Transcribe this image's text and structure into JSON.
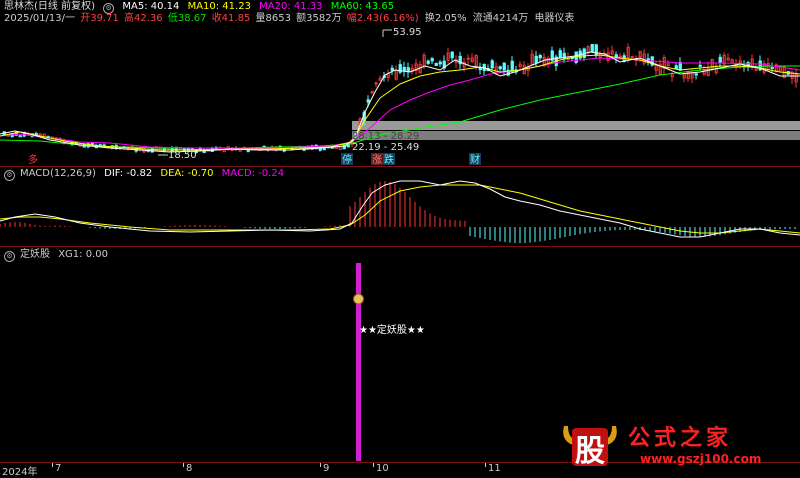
{
  "header": {
    "stock": "思林杰(日线 前复权)",
    "ma5": "MA5: 40.14",
    "ma10": "MA10: 41.23",
    "ma20": "MA20: 41.33",
    "ma60": "MA60: 43.65",
    "date": "2025/01/13/一",
    "open": "开39.71",
    "high": "高42.36",
    "low": "低38.67",
    "close": "收41.85",
    "volume": "量8653",
    "amount": "额3582万",
    "change": "幅2.43(6.16%)",
    "turnover": "换2.05%",
    "float": "流通4214万",
    "sector": "电器仪表"
  },
  "price_chart": {
    "high_label": "53.95",
    "low_label": "18.50",
    "range1": "28.13 - 28.29",
    "range2": "22.19 - 25.49",
    "marks": {
      "ting": "停",
      "zhang": "涨",
      "die": "跌",
      "cai": "财",
      "left": "多"
    }
  },
  "macd": {
    "title": "MACD(12,26,9)",
    "dif": "DIF: -0.82",
    "dea": "DEA: -0.70",
    "macd": "MACD: -0.24"
  },
  "indicator": {
    "title": "定妖股",
    "xg1": "XG1: 0.00",
    "signal": "★★定妖股★★"
  },
  "axis": {
    "labels": [
      "2024年",
      "7",
      "8",
      "9",
      "10",
      "11"
    ]
  },
  "watermark": {
    "logo": "股",
    "text": "公式之家",
    "url": "www.gszj100.com"
  },
  "colors": {
    "ma5": "#ffffff",
    "ma10": "#ffff00",
    "ma20": "#ff00ff",
    "ma60": "#00ff00",
    "up": "#ff3232",
    "down": "#54ffff",
    "signal": "#d020d0"
  }
}
